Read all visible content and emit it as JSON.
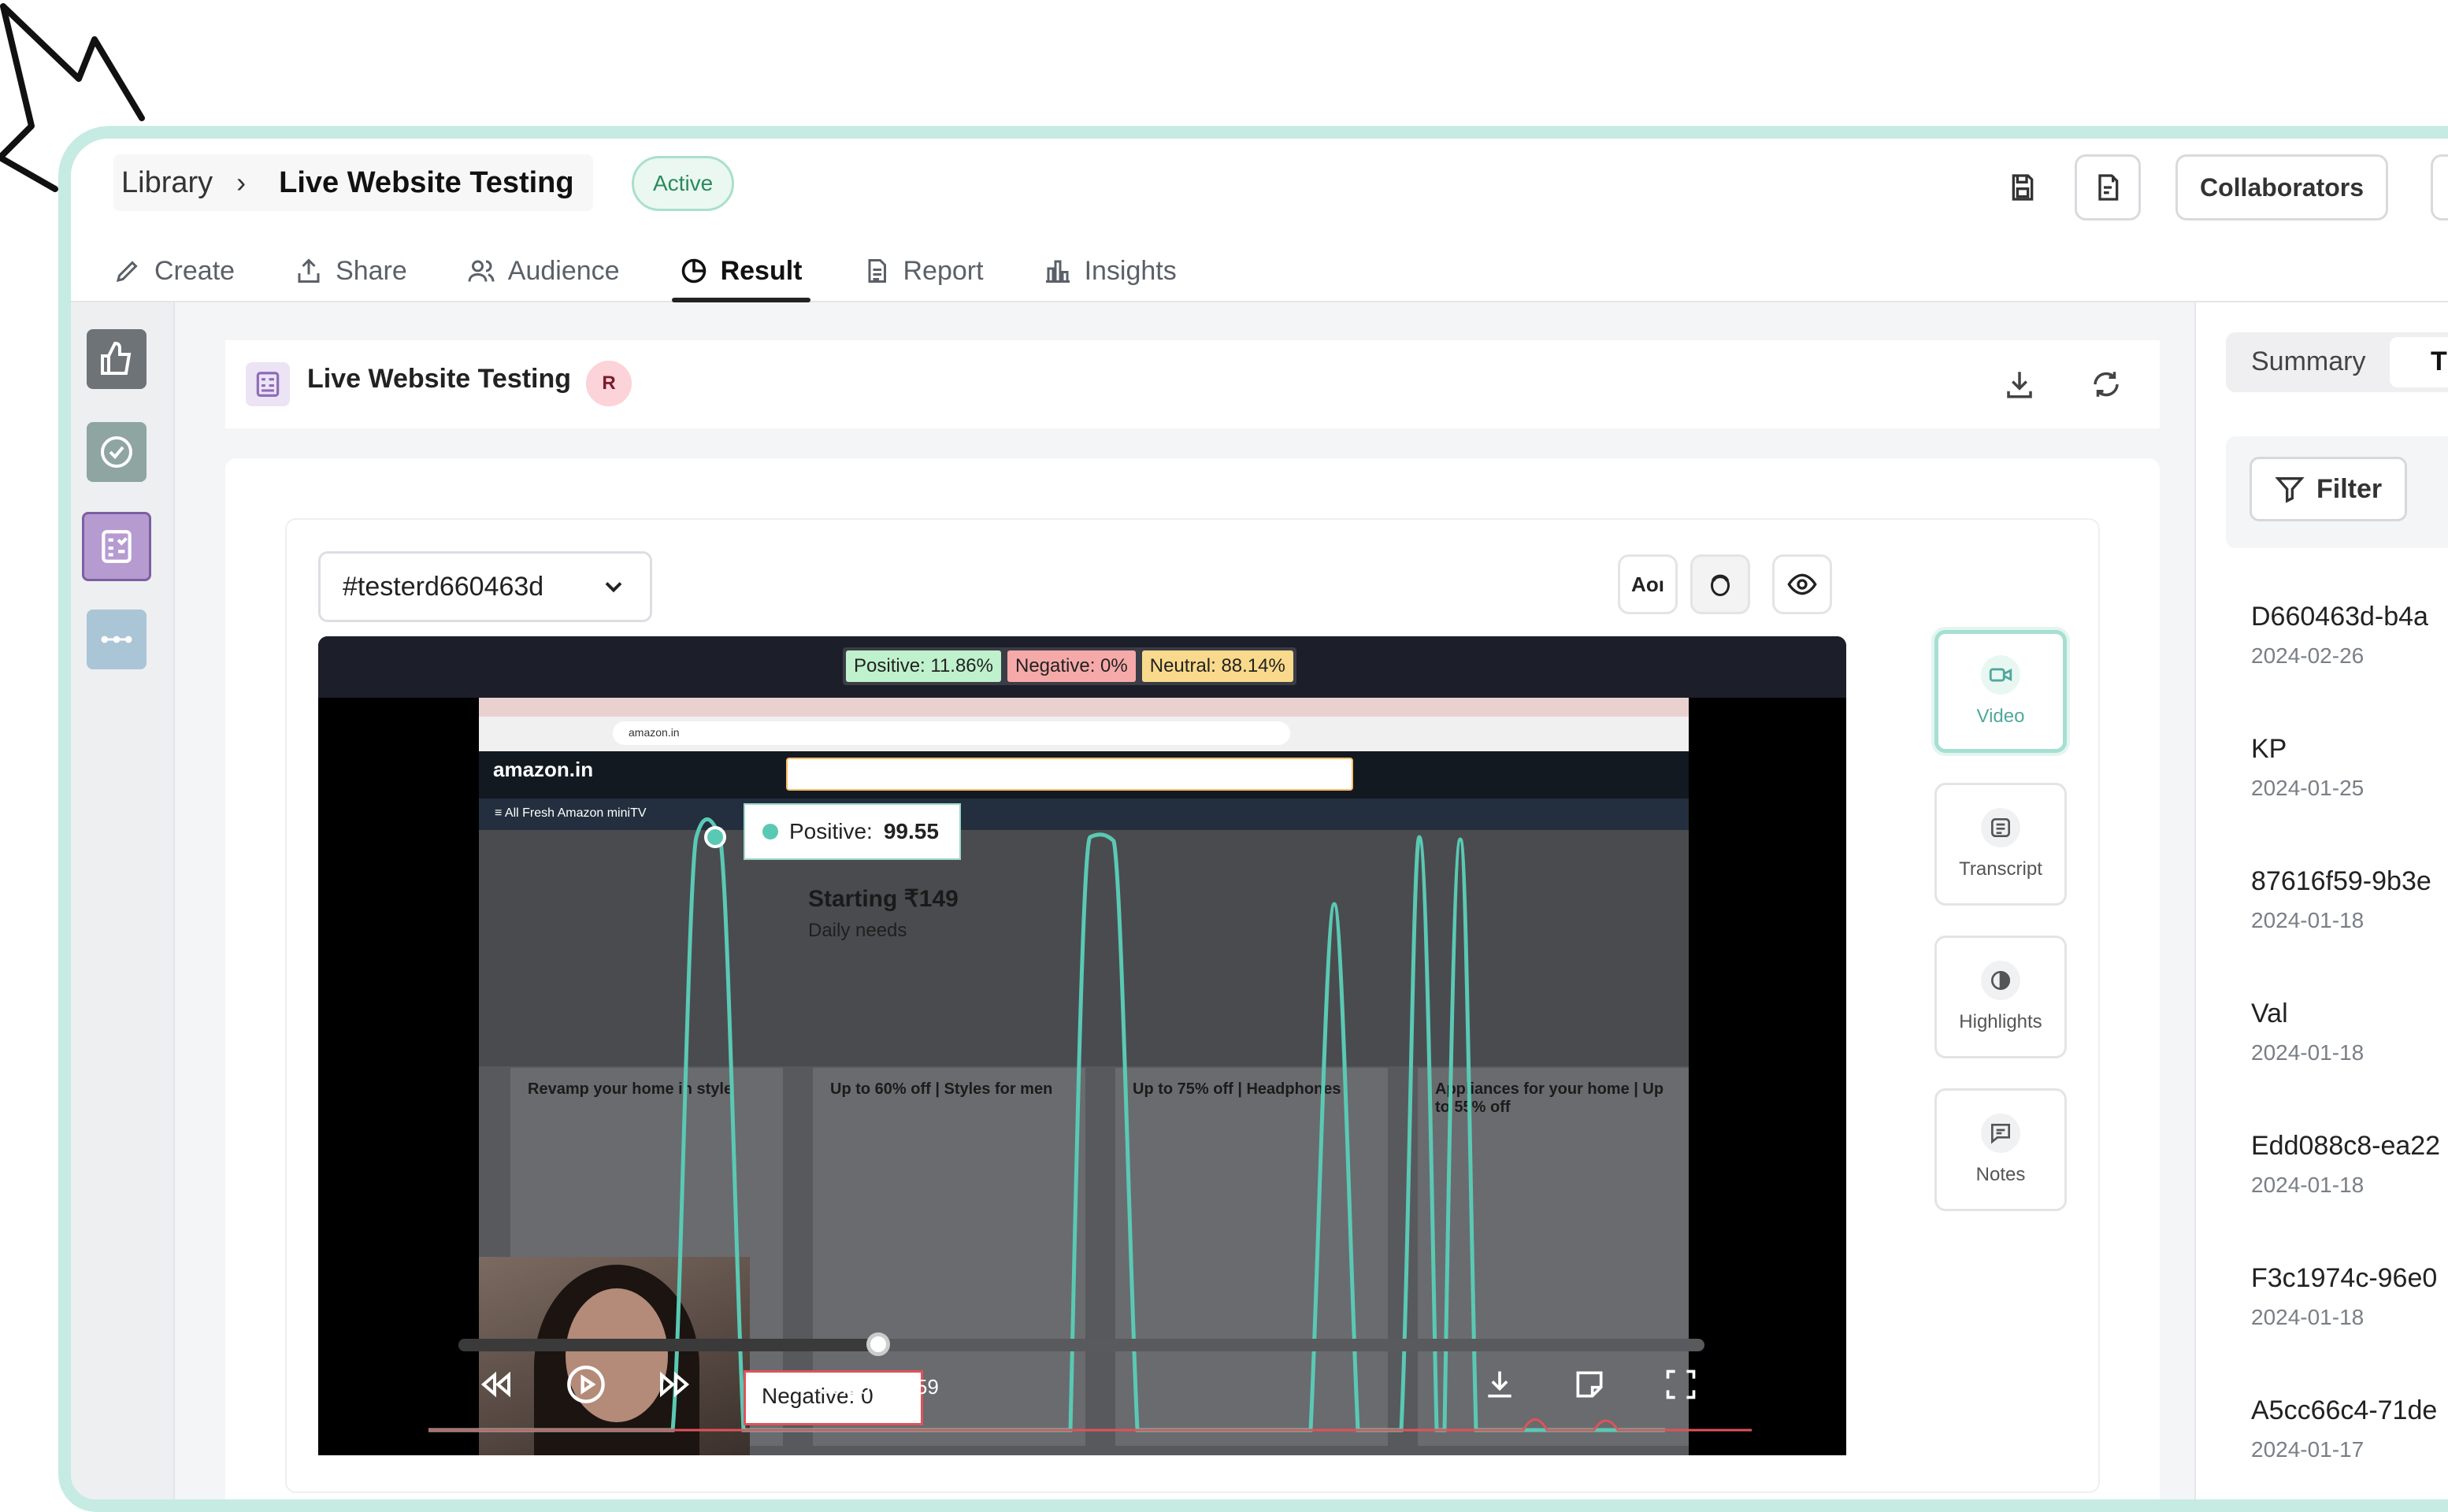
{
  "breadcrumb": {
    "library": "Library",
    "separator": "›",
    "title": "Live Website Testing"
  },
  "status_badge": "Active",
  "toolbar": {
    "collaborators": "Collaborators"
  },
  "tabs": [
    {
      "label": "Create",
      "icon": "pencil-icon"
    },
    {
      "label": "Share",
      "icon": "share-upload-icon"
    },
    {
      "label": "Audience",
      "icon": "users-icon"
    },
    {
      "label": "Result",
      "icon": "pie-chart-icon",
      "active": true
    },
    {
      "label": "Report",
      "icon": "document-icon"
    },
    {
      "label": "Insights",
      "icon": "bar-chart-icon"
    }
  ],
  "main": {
    "title": "Live Website Testing",
    "avatar_initial": "R",
    "tester_select": "#testerd660463d",
    "aoi_label": "Aoı"
  },
  "player": {
    "sentiment": {
      "positive": "Positive:  11.86%",
      "negative": "Negative:  0%",
      "neutral": "Neutral:  88.14%"
    },
    "positive_tooltip": {
      "label": "Positive:",
      "value": "99.55"
    },
    "negative_tooltip": "Negative: 0",
    "time": "00:20 / 00:59",
    "progress": 0.339,
    "screen": {
      "url": "amazon.in",
      "logo": "amazon.in",
      "nav": "≡ All   Fresh   Amazon miniTV",
      "hero_title": "Starting ₹149",
      "hero_sub": "Daily needs",
      "cards": [
        "Revamp your home in style",
        "Up to 60% off | Styles for men",
        "Up to 75% off | Headphones",
        "Appliances for your home | Up to 55% off"
      ]
    }
  },
  "side_tools": [
    {
      "label": "Video",
      "icon": "video-camera-icon",
      "active": true
    },
    {
      "label": "Transcript",
      "icon": "transcript-icon"
    },
    {
      "label": "Highlights",
      "icon": "highlights-icon"
    },
    {
      "label": "Notes",
      "icon": "notes-icon"
    }
  ],
  "right_panel": {
    "summary_tab": "Summary",
    "next_tab": "T",
    "filter": "Filter",
    "testers": [
      {
        "id": "D660463d-b4a",
        "date": "2024-02-26"
      },
      {
        "id": "KP",
        "date": "2024-01-25"
      },
      {
        "id": "87616f59-9b3e",
        "date": "2024-01-18"
      },
      {
        "id": "Val",
        "date": "2024-01-18"
      },
      {
        "id": "Edd088c8-ea22",
        "date": "2024-01-18"
      },
      {
        "id": "F3c1974c-96e0",
        "date": "2024-01-18"
      },
      {
        "id": "A5cc66c4-71de",
        "date": "2024-01-17"
      }
    ]
  },
  "colors": {
    "frame": "#c6ebe3",
    "accent": "#5ac9b4",
    "negative": "#e0525a"
  }
}
